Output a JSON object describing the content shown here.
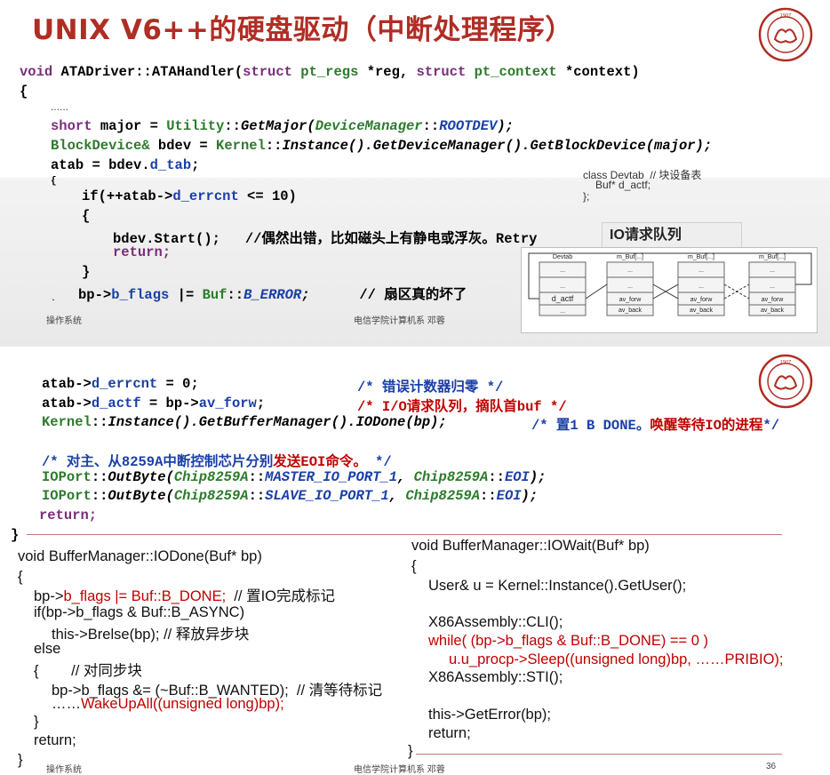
{
  "slide1": {
    "title": "UNIX V6++的硬盘驱动（中断处理程序）",
    "code": {
      "l1_void": "void",
      "l1_name": " ATADriver::ATAHandler(",
      "l1_struct1": "struct",
      "l1_t1": " pt_regs",
      "l1_p1": " *reg, ",
      "l1_struct2": "struct",
      "l1_t2": " pt_context",
      "l1_p2": " *context)",
      "l2": "{",
      "l3": "……",
      "l4_short": "short",
      "l4_a": " major = ",
      "l4_util": "Utility",
      "l4_b": "::",
      "l4_get": "GetMajor(",
      "l4_dm": "DeviceManager",
      "l4_c": "::",
      "l4_root": "ROOTDEV",
      "l4_d": ");",
      "l5_bd": "BlockDevice&",
      "l5_a": " bdev = ",
      "l5_k": "Kernel",
      "l5_b": "::",
      "l5_rest": "Instance().GetDeviceManager().GetBlockDevice(major);",
      "l6_a": "atab = bdev.",
      "l6_b": "d_tab",
      "l6_c": ";",
      "l7": "{",
      "l8_if": "if(++atab->",
      "l8_f": "d_errcnt",
      "l8_c": " <= 10)",
      "l9": "{",
      "l10_a": "bdev.Start();",
      "l10_comment": "//偶然出错，比如磁头上有静电或浮灰。Retry",
      "l11": "return;",
      "l12": "}",
      "l13_a": "bp->",
      "l13_f": "b_flags",
      "l13_b": " |= ",
      "l13_buf": "Buf",
      "l13_c": "::",
      "l13_e": "B_ERROR",
      "l13_d": ";",
      "l13_comment": "// 扇区真的坏了",
      "l14": "`"
    },
    "devtab_decl": "class Devtab  // 块设备表",
    "devtab_l2": "Buf* d_actf;",
    "devtab_l3": "};",
    "io_queue_label": "IO请求队列",
    "diagram": {
      "devtab": "Devtab",
      "buf1": "m_Buf[...]",
      "buf2": "m_Buf[...]",
      "buf3": "m_Buf[...]",
      "dots": "...",
      "actf": "d_actf",
      "avforw": "av_forw",
      "avback": "av_back"
    },
    "footer_left": "操作系统",
    "footer_center": "电信学院计算机系 邓蓉"
  },
  "slide2": {
    "l1_a": "atab->",
    "l1_f": "d_errcnt",
    "l1_b": " = 0;",
    "l1_comment": "/* 错误计数器归零 */",
    "l2_a": "atab->",
    "l2_f": "d_actf",
    "l2_b": " = bp->",
    "l2_g": "av_forw",
    "l2_c": ";",
    "l2_comment": "/* I/O请求队列，摘队首buf */",
    "l3_k": "Kernel",
    "l3_a": "::",
    "l3_rest": "Instance().GetBufferManager().IODone(bp);",
    "l3_comment_a": "/* 置1 B DONE。",
    "l3_comment_b": "唤醒等待IO的进程",
    "l3_comment_c": "*/",
    "l4_comment_a": "/* 对主、从8259A中断控制芯片分别",
    "l4_comment_b": "发送EOI命令。",
    "l4_comment_c": " */",
    "l5_a": "IOPort",
    "l5_b": "::",
    "l5_c": "OutByte(",
    "l5_d": "Chip8259A",
    "l5_e": "::",
    "l5_f": "MASTER_IO_PORT_1",
    "l5_g": ", ",
    "l5_h": "Chip8259A",
    "l5_i": "::",
    "l5_j": "EOI",
    "l5_k": ");",
    "l6_a": "IOPort",
    "l6_b": "::",
    "l6_c": "OutByte(",
    "l6_d": "Chip8259A",
    "l6_e": "::",
    "l6_f": "SLAVE_IO_PORT_1",
    "l6_g": ", ",
    "l6_h": "Chip8259A",
    "l6_i": "::",
    "l6_j": "EOI",
    "l6_k": ");",
    "l7": "return;",
    "l8": "}",
    "iodone": {
      "h": "void BufferManager::IODone(Buf* bp)",
      "o": "{",
      "a1": "bp->",
      "a2": "b_flags |= Buf::B_DONE;",
      "a3": "  // 置IO完成标记",
      "b": "if(bp->b_flags & Buf::B_ASYNC)",
      "c": "this->Brelse(bp); // 释放异步块",
      "d": "else",
      "e": "{        // 对同步块",
      "f": "bp->b_flags &= (~Buf::B_WANTED);  // 清等待标记",
      "g1": "……",
      "g2": "WakeUpAll((unsigned long)bp);",
      "h2": "}",
      "i": "return;",
      "j": "}"
    },
    "iowait": {
      "h": "void BufferManager::IOWait(Buf* bp)",
      "o": "{",
      "a": "User& u = Kernel::Instance().GetUser();",
      "b": "X86Assembly::CLI();",
      "c": "while( (bp->b_flags & Buf::B_DONE) == 0 )",
      "d": "u.u_procp->Sleep((unsigned long)bp, ……PRIBIO);",
      "e": "X86Assembly::STI();",
      "f": "this->GetError(bp);",
      "g": "return;",
      "j": "}"
    },
    "footer_left": "操作系统",
    "footer_center": "电信学院计算机系 邓蓉",
    "page_number": "36"
  },
  "seal_text": "1907",
  "colors": {
    "title": "#b02d24",
    "keyword": "#7a2e7a",
    "type": "#2e7a2e",
    "member": "#1a3fa8",
    "highlight": "#c00000"
  }
}
